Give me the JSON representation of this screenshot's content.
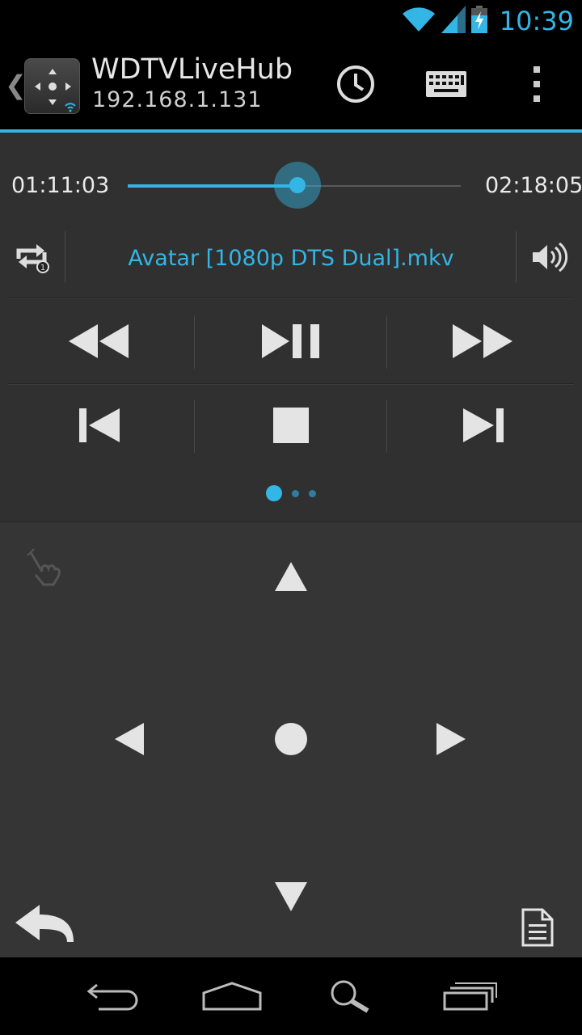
{
  "status_bar": {
    "time": "10:39",
    "icons": [
      "wifi-icon",
      "signal-icon",
      "battery-charging-icon"
    ]
  },
  "action_bar": {
    "device_name": "WDTVLiveHub",
    "device_ip": "192.168.1.131",
    "actions": [
      "history-icon",
      "keyboard-icon",
      "overflow-menu-icon"
    ]
  },
  "player": {
    "elapsed": "01:11:03",
    "duration": "02:18:05",
    "progress": 0.51,
    "file_name": "Avatar [1080p DTS Dual].mkv",
    "repeat_mode": "repeat-one-icon",
    "volume": "volume-icon",
    "row1": [
      "rewind-icon",
      "play-pause-icon",
      "fast-forward-icon"
    ],
    "row2": [
      "skip-previous-icon",
      "stop-icon",
      "skip-next-icon"
    ],
    "pages": 3,
    "current_page": 0
  },
  "pad": {
    "icons": [
      "gesture-icon",
      "up-arrow-icon",
      "left-arrow-icon",
      "ok-icon",
      "right-arrow-icon",
      "down-arrow-icon",
      "back-icon",
      "document-icon"
    ]
  },
  "navbar": {
    "icons": [
      "nav-back-icon",
      "nav-home-icon",
      "nav-search-icon",
      "nav-recents-icon"
    ]
  },
  "colors": {
    "accent": "#33b5e5",
    "panel": "#303030",
    "pad": "#353535"
  }
}
